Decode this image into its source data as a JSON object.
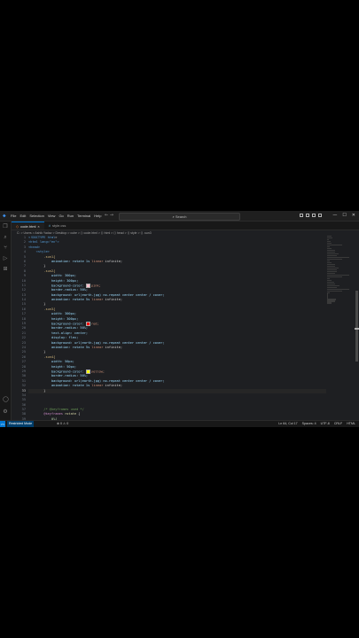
{
  "menu": [
    "File",
    "Edit",
    "Selection",
    "View",
    "Go",
    "Run",
    "Terminal",
    "Help"
  ],
  "nav": {
    "back": "←",
    "forward": "→"
  },
  "search": {
    "placeholder": "Search"
  },
  "window_controls": [
    "—",
    "☐",
    "✕"
  ],
  "tabs": [
    {
      "label": "code.html",
      "icon": "html-file-icon",
      "active": true,
      "close": "×"
    },
    {
      "label": "style.css",
      "icon": "css-file-icon",
      "active": false,
      "close": ""
    }
  ],
  "breadcrumb": "C: > Users > Ashik Yadav > Desktop > cube > ⟨⟩ code.html > ⟨⟩ html > ⟨⟩ head > ⟨⟩ style > ⟨⟩ .sun3",
  "line_numbers": [
    "1",
    "2",
    "3",
    "4",
    "5",
    "6",
    "7",
    "8",
    "9",
    "10",
    "11",
    "12",
    "13",
    "14",
    "15",
    "16",
    "17",
    "18",
    "19",
    "20",
    "21",
    "22",
    "23",
    "24",
    "25",
    "26",
    "27",
    "28",
    "29",
    "30",
    "31",
    "32",
    "33",
    "34",
    "35",
    "36",
    "37",
    "38",
    "39"
  ],
  "code_lines": [
    [
      {
        "t": "<!DOCTYPE ",
        "c": "tag"
      },
      {
        "t": "html",
        "c": "tag"
      },
      {
        "t": ">",
        "c": "pun"
      }
    ],
    [
      {
        "t": "<html lang=\"en\">",
        "c": "tag"
      }
    ],
    [
      {
        "t": "<head>",
        "c": "tag"
      }
    ],
    [
      {
        "t": "    <style>",
        "c": "tag"
      }
    ],
    [
      {
        "t": "        .sun1{",
        "c": "sel"
      }
    ],
    [
      {
        "t": "            animation: rotate 1s ",
        "c": "prop"
      },
      {
        "t": "linear",
        "c": "val"
      },
      {
        "t": " infinite;",
        "c": "pun"
      }
    ],
    [
      {
        "t": "        }",
        "c": "pun"
      }
    ],
    [
      {
        "t": "        .sun2{",
        "c": "sel"
      }
    ],
    [
      {
        "t": "            width: 300px;",
        "c": "prop"
      }
    ],
    [
      {
        "t": "            height: 300px;",
        "c": "prop"
      }
    ],
    [
      {
        "t": "            background-color: ",
        "c": "prop"
      },
      {
        "sw": "#ffc0cb"
      },
      {
        "t": "pink;",
        "c": "val"
      }
    ],
    [
      {
        "t": "            border-radius: 50%;",
        "c": "prop"
      }
    ],
    [
      {
        "t": "            background: url(earth.jpg) no-repeat center center / cover;",
        "c": "prop"
      }
    ],
    [
      {
        "t": "            animation: rotate 5s ",
        "c": "prop"
      },
      {
        "t": "linear",
        "c": "val"
      },
      {
        "t": " infinite;",
        "c": "pun"
      }
    ],
    [
      {
        "t": "        }",
        "c": "pun"
      }
    ],
    [
      {
        "t": "        .sun3{",
        "c": "sel"
      }
    ],
    [
      {
        "t": "            width: 300px;",
        "c": "prop"
      }
    ],
    [
      {
        "t": "            height: 300px;",
        "c": "prop"
      }
    ],
    [
      {
        "t": "            background-color: ",
        "c": "prop"
      },
      {
        "sw": "#ff0000"
      },
      {
        "t": "red;",
        "c": "val"
      }
    ],
    [
      {
        "t": "            border-radius: 50%;",
        "c": "prop"
      }
    ],
    [
      {
        "t": "            text-align: center;",
        "c": "prop"
      }
    ],
    [
      {
        "t": "            display: flex;",
        "c": "prop"
      }
    ],
    [
      {
        "t": "            background: url(earth.jpg) no-repeat center center / cover;",
        "c": "prop"
      }
    ],
    [
      {
        "t": "            animation: rotate 5s ",
        "c": "prop"
      },
      {
        "t": "linear",
        "c": "val"
      },
      {
        "t": " infinite;",
        "c": "pun"
      }
    ],
    [
      {
        "t": "        }",
        "c": "pun"
      }
    ],
    [
      {
        "t": "        .sun4{",
        "c": "sel"
      }
    ],
    [
      {
        "t": "            width: 50px;",
        "c": "prop"
      }
    ],
    [
      {
        "t": "            height: 50px;",
        "c": "prop"
      }
    ],
    [
      {
        "t": "            background-color: ",
        "c": "prop"
      },
      {
        "sw": "#ffff00"
      },
      {
        "t": "yellow;",
        "c": "val"
      }
    ],
    [
      {
        "t": "            border-radius: 50%;",
        "c": "prop"
      }
    ],
    [
      {
        "t": "            background: url(earth.jpg) no-repeat center center / cover;",
        "c": "prop"
      }
    ],
    [
      {
        "t": "            animation: rotate 1s ",
        "c": "prop"
      },
      {
        "t": "linear",
        "c": "val"
      },
      {
        "t": " infinite;",
        "c": "pun"
      }
    ],
    [
      {
        "t": "        }",
        "c": "pun"
      }
    ],
    [
      {
        "t": "",
        "c": "pun"
      }
    ],
    [
      {
        "t": "",
        "c": "pun"
      }
    ],
    [
      {
        "t": "",
        "c": "pun"
      }
    ],
    [
      {
        "t": "        /* @keyframes used */",
        "c": "com"
      }
    ],
    [
      {
        "t": "        @keyframes ",
        "c": "key"
      },
      {
        "t": "rotate",
        "c": "fn"
      },
      {
        "t": " {",
        "c": "pun"
      }
    ],
    [
      {
        "t": "            0%{",
        "c": "num"
      }
    ]
  ],
  "status": {
    "remote_icon": "><",
    "restricted": "Restricted Mode",
    "errors": "⊗ 0  ⚠ 0",
    "position": "Ln 64, Col 17",
    "spaces": "Spaces: 4",
    "encoding": "UTF-8",
    "eol": "CRLF",
    "language": "HTML"
  }
}
